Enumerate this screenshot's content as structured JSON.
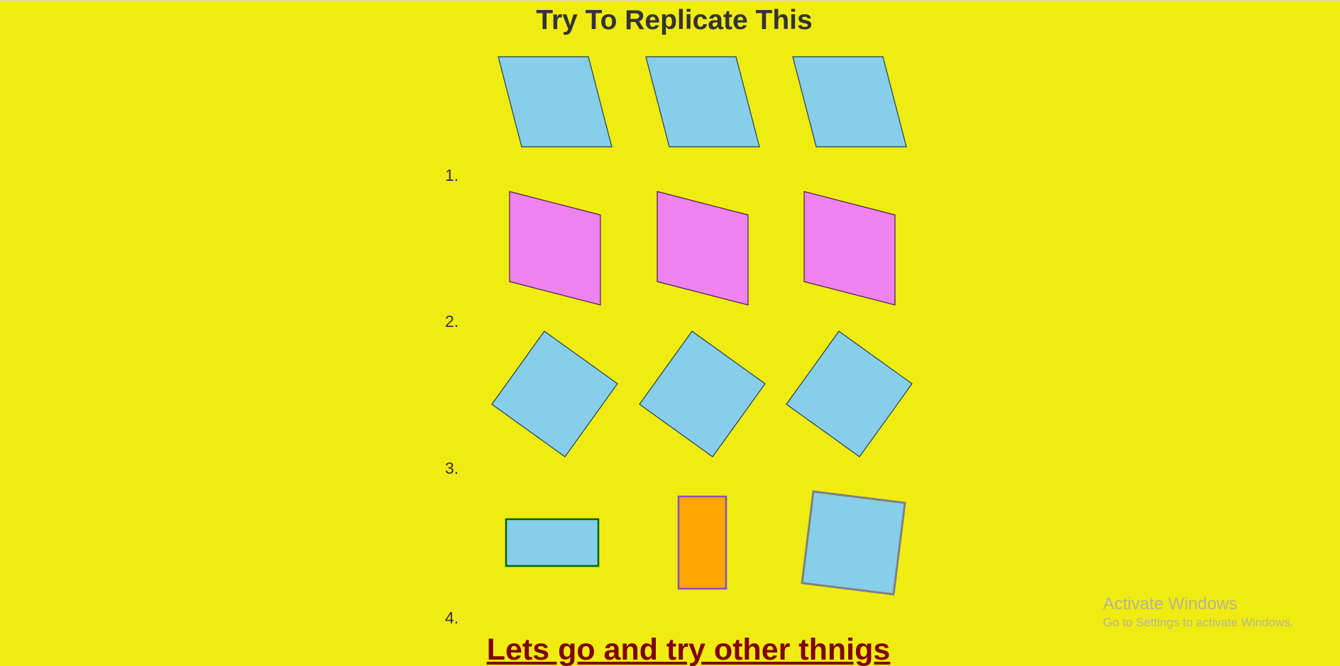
{
  "page": {
    "title": "Try To Replicate This",
    "link_text": "Lets go and try other thnigs",
    "background_color": "#f0ec12"
  },
  "list_markers": [
    "1.",
    "2.",
    "3.",
    "4."
  ],
  "shape_colors": {
    "sky_blue": "#87ceeb",
    "violet": "#ee82ee",
    "orange": "#ffa500",
    "dark_green_border": "#006400",
    "purple_border": "#8a4fbf",
    "gray_border": "#808080",
    "link_color": "#800000"
  },
  "watermark": {
    "title": "Activate Windows",
    "subtitle": "Go to Settings to activate Windows."
  }
}
